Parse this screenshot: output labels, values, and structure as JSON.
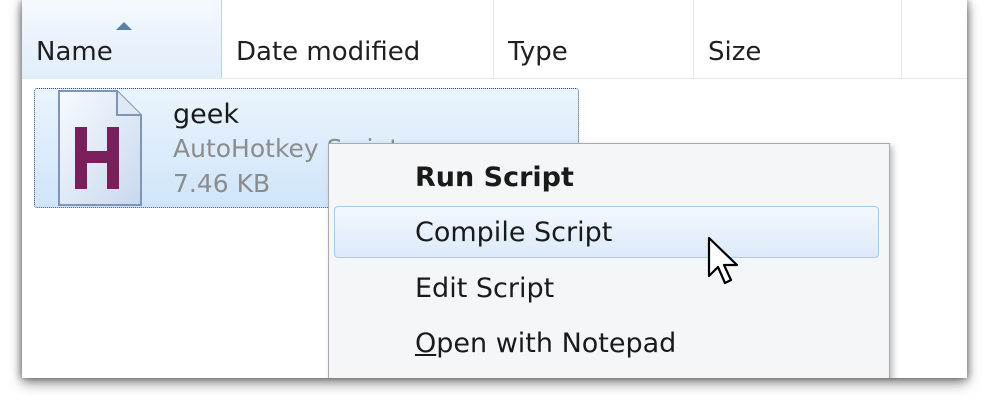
{
  "columns": {
    "name": "Name",
    "date_modified": "Date modified",
    "type": "Type",
    "size": "Size"
  },
  "file": {
    "name": "geek",
    "type": "AutoHotkey Script",
    "size": "7.46 KB",
    "icon": "autohotkey-file-icon"
  },
  "context_menu": {
    "items": [
      {
        "label": "Run Script",
        "default": true
      },
      {
        "label": "Compile Script",
        "hovered": true
      },
      {
        "label": "Edit Script"
      },
      {
        "label_first": "O",
        "label_rest": "pen with Notepad"
      }
    ]
  },
  "colors": {
    "selection": "#cfe5fa",
    "hover_border": "#a7cbee",
    "icon_letter": "#7a1f5c"
  }
}
